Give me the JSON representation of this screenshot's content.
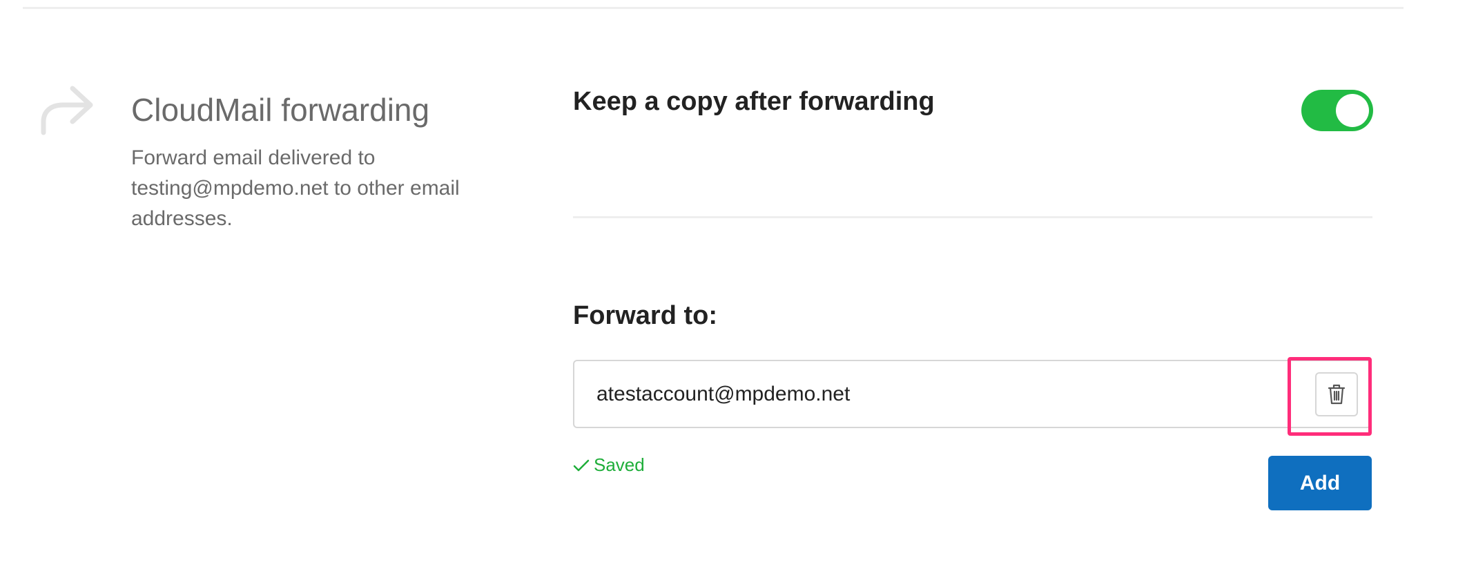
{
  "section": {
    "title": "CloudMail forwarding",
    "description": "Forward email delivered to testing@mpdemo.net to other email addresses.",
    "icon": "forward-arrow-icon"
  },
  "keep_copy": {
    "label": "Keep a copy after forwarding",
    "enabled": true,
    "toggle_color": "#22bb44"
  },
  "forward_to": {
    "label": "Forward to:",
    "email_value": "atestaccount@mpdemo.net",
    "delete_icon": "trash-icon",
    "saved_text": "Saved",
    "saved_icon": "check-icon",
    "add_label": "Add"
  },
  "colors": {
    "accent": "#0f6fbf",
    "success": "#1fae3a",
    "highlight": "#ff2d7a"
  }
}
